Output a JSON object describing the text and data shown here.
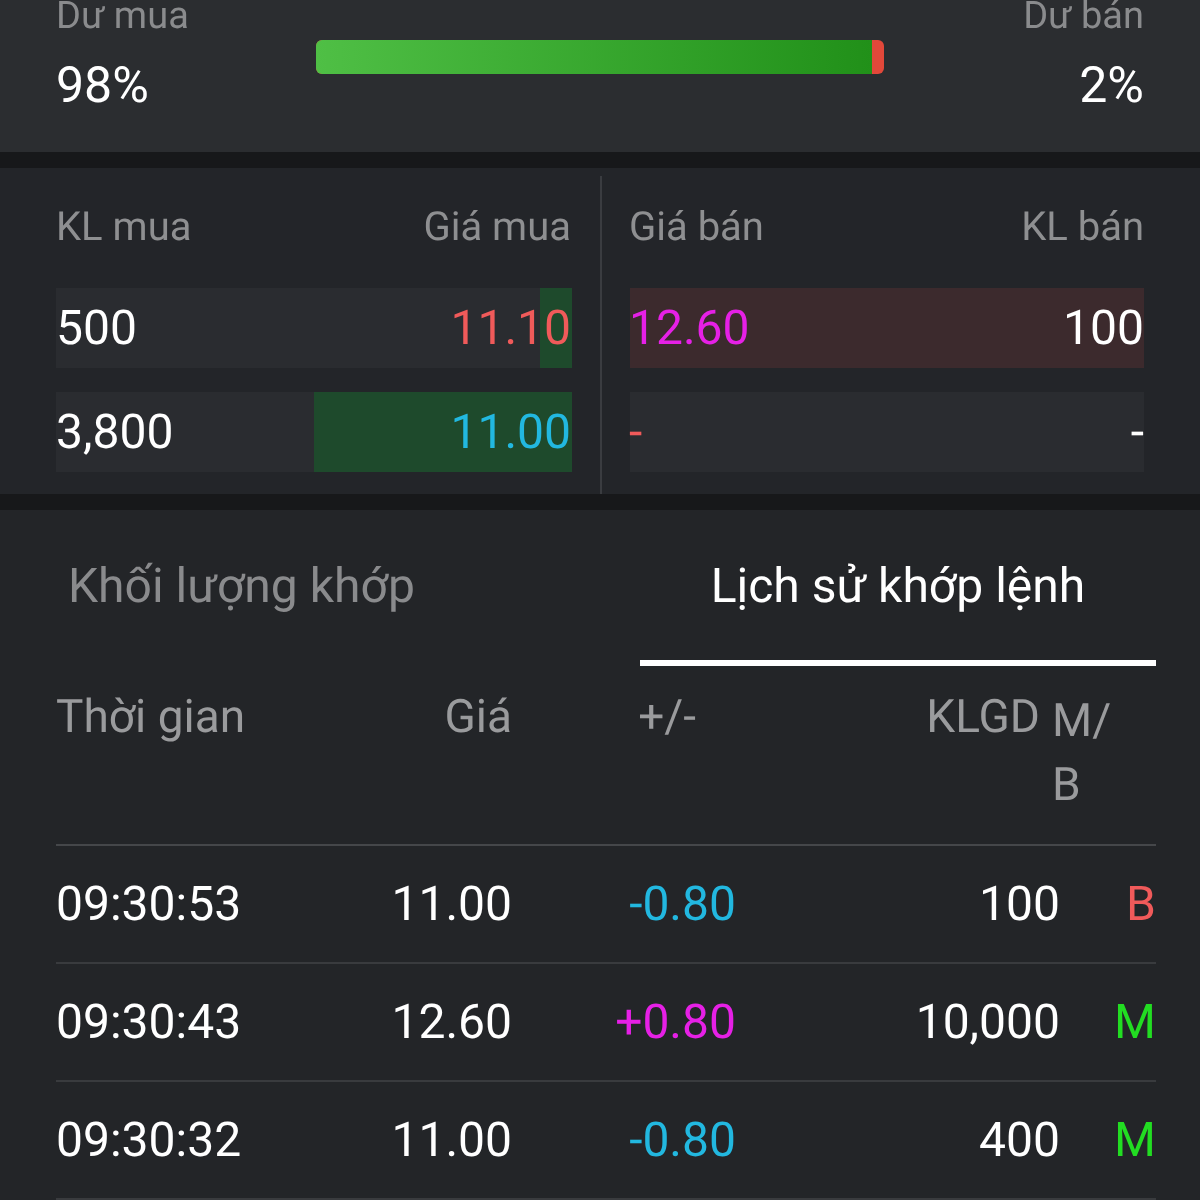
{
  "balance": {
    "buy_label": "Dư mua",
    "buy_value": "98%",
    "sell_label": "Dư bán",
    "sell_value": "2%",
    "level": 0.98
  },
  "order_book": {
    "columns": [
      "KL mua",
      "Giá mua",
      "Giá bán",
      "KL bán"
    ],
    "rows": [
      {
        "bid": {
          "volume": "500",
          "price": "11.10",
          "color": "#f05a5a",
          "level": 0.06
        },
        "ask": {
          "price": "12.60",
          "color": "#e620e6",
          "level": 1.0,
          "volume": "100"
        }
      },
      {
        "bid": {
          "volume": "3,800",
          "price": "11.00",
          "color": "#22b8e0",
          "level": 0.5
        },
        "ask": {
          "price": "-",
          "color": "#f05a5a",
          "level": 0,
          "volume": "-"
        }
      }
    ]
  },
  "tabs": [
    {
      "label": "Khối lượng khớp",
      "selected": false
    },
    {
      "label": "Lịch sử khớp lệnh",
      "selected": true
    }
  ],
  "trades": {
    "columns": [
      "Thời gian",
      "Giá",
      "+/-",
      "KLGD",
      "M/B"
    ],
    "rows": [
      {
        "time": "09:30:53",
        "price": "11.00",
        "change": {
          "text": "-0.80",
          "color": "#22b8e0"
        },
        "volume": "100",
        "side": {
          "text": "B",
          "color": "#f05a5a"
        }
      },
      {
        "time": "09:30:43",
        "price": "12.60",
        "change": {
          "text": "+0.80",
          "color": "#e620e6"
        },
        "volume": "10,000",
        "side": {
          "text": "M",
          "color": "#22dd22"
        }
      },
      {
        "time": "09:30:32",
        "price": "11.00",
        "change": {
          "text": "-0.80",
          "color": "#22b8e0"
        },
        "volume": "400",
        "side": {
          "text": "M",
          "color": "#22dd22"
        }
      }
    ]
  }
}
